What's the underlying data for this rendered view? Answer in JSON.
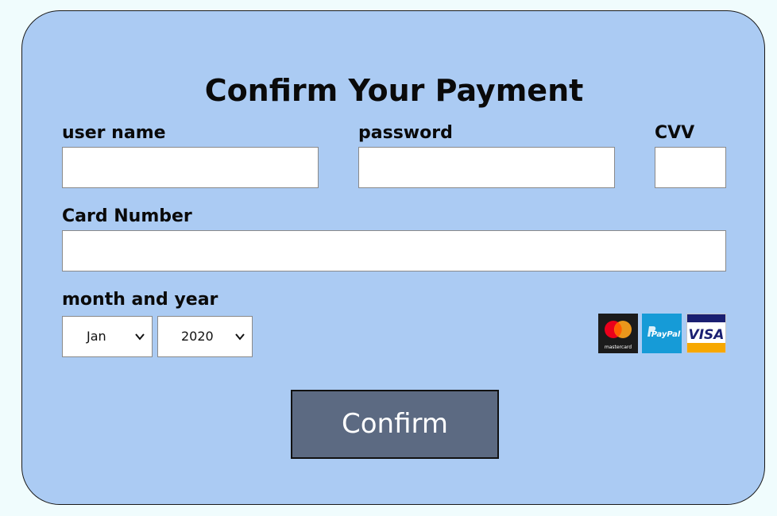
{
  "form": {
    "title": "Confirm Your Payment",
    "username": {
      "label": "user name",
      "value": ""
    },
    "password": {
      "label": "password",
      "value": ""
    },
    "cvv": {
      "label": "CVV",
      "value": ""
    },
    "card_number": {
      "label": "Card Number",
      "value": ""
    },
    "expiry": {
      "label": "month and year",
      "month": "Jan",
      "year": "2020"
    },
    "payment_methods": [
      {
        "name": "mastercard-logo",
        "text": "mastercard"
      },
      {
        "name": "paypal-logo",
        "text": "PayPal"
      },
      {
        "name": "visa-logo",
        "text": "VISA"
      }
    ],
    "confirm_label": "Confirm"
  },
  "colors": {
    "page_bg": "#f0fcfd",
    "card_bg": "#abcbf3",
    "button_bg": "#5c6a82",
    "button_text": "#ffffff"
  }
}
